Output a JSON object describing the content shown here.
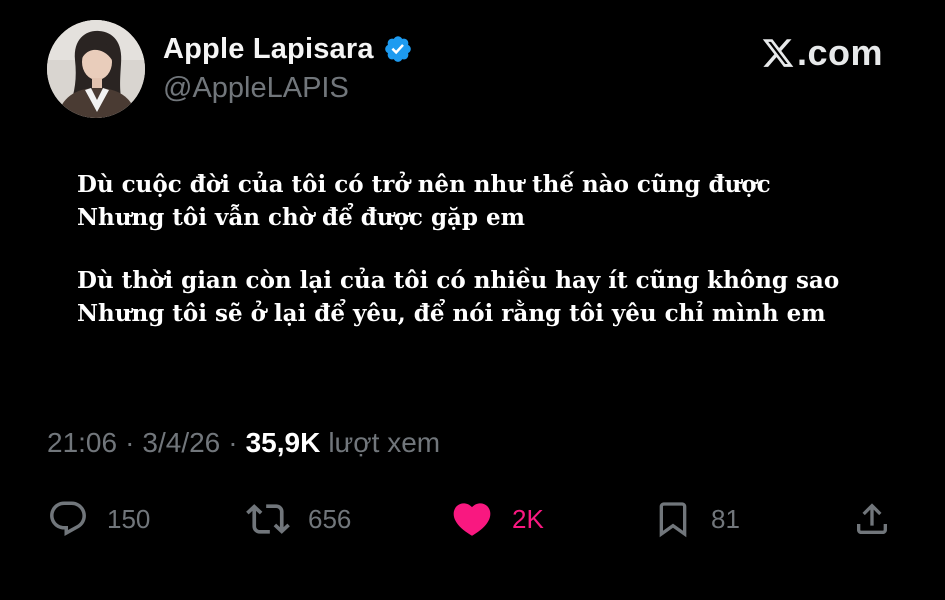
{
  "profile": {
    "display_name": "Apple Lapisara",
    "handle": "@AppleLAPIS",
    "verified": true,
    "verified_icon": "verified-badge-icon",
    "avatar_icon": "avatar-photo"
  },
  "site": {
    "label": ".com",
    "logo_icon": "x-logo-icon"
  },
  "tweet": {
    "lines": [
      "Dù cuộc đời của tôi có trở nên như thế nào cũng được",
      "Nhưng tôi vẫn chờ để được gặp em",
      "",
      "Dù thời gian còn lại của tôi có nhiều hay ít cũng không sao",
      "Nhưng tôi sẽ ở lại để yêu, để nói rằng tôi yêu chỉ mình em"
    ]
  },
  "meta": {
    "time": "21:06",
    "separator": "·",
    "date": "3/4/26",
    "views_count": "35,9K",
    "views_label": "lượt xem"
  },
  "actions": {
    "reply_count": "150",
    "retweet_count": "656",
    "like_count": "2K",
    "bookmark_count": "81",
    "reply_icon": "reply-icon",
    "retweet_icon": "retweet-icon",
    "like_icon": "heart-icon",
    "bookmark_icon": "bookmark-icon",
    "share_icon": "share-icon"
  },
  "colors": {
    "background": "#000000",
    "text_primary": "#ffffff",
    "text_secondary": "#71767b",
    "verified_blue": "#1d9bf0",
    "like_pink": "#f91880"
  }
}
